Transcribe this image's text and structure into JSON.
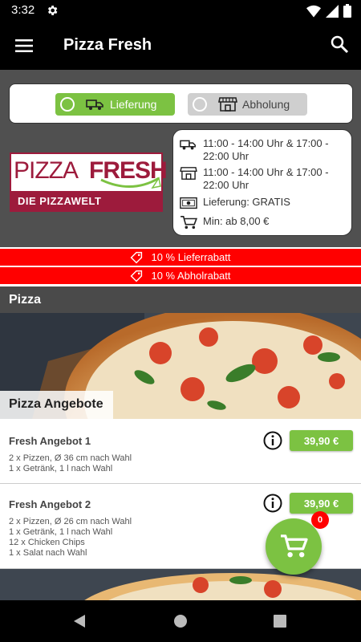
{
  "status_bar": {
    "time": "3:32",
    "settings_icon": "gear-icon",
    "wifi_icon": "wifi-icon",
    "signal_icon": "signal-icon",
    "battery_icon": "battery-icon"
  },
  "app_bar": {
    "title": "Pizza Fresh",
    "menu_icon": "menu-icon",
    "search_icon": "search-icon"
  },
  "order_mode": {
    "delivery_label": "Lieferung",
    "pickup_label": "Abholung",
    "selected": "none"
  },
  "logo": {
    "word1": "PIZZA",
    "word2": "FRESH",
    "tagline": "DIE PIZZAWELT"
  },
  "info": {
    "delivery_hours": "11:00 - 14:00 Uhr & 17:00 - 22:00 Uhr",
    "pickup_hours": "11:00 - 14:00 Uhr & 17:00 - 22:00 Uhr",
    "delivery_fee": "Lieferung: GRATIS",
    "minimum": "Min: ab 8,00 €"
  },
  "discounts": [
    "10 % Lieferrabatt",
    "10 % Abholrabatt"
  ],
  "section": {
    "title": "Pizza",
    "banner_label": "Pizza Angebote"
  },
  "items": [
    {
      "name": "Fresh Angebot 1",
      "description": [
        "2 x Pizzen, Ø 36 cm nach Wahl",
        "1 x Getränk, 1 l nach Wahl"
      ],
      "price": "39,90 €"
    },
    {
      "name": "Fresh Angebot 2",
      "description": [
        "2 x Pizzen, Ø 26 cm nach Wahl",
        "1 x Getränk, 1 l nach Wahl",
        "12 x Chicken Chips",
        "1 x Salat nach Wahl"
      ],
      "price": "39,90 €"
    }
  ],
  "cart": {
    "count": "0",
    "icon": "cart-icon"
  },
  "nav_bar": {
    "back_icon": "back-icon",
    "home_icon": "home-icon",
    "recents_icon": "recents-icon"
  },
  "colors": {
    "accent": "#7cc242",
    "discount": "#ff0000",
    "brand": "#9d1b3c",
    "header_bg": "#505050"
  }
}
